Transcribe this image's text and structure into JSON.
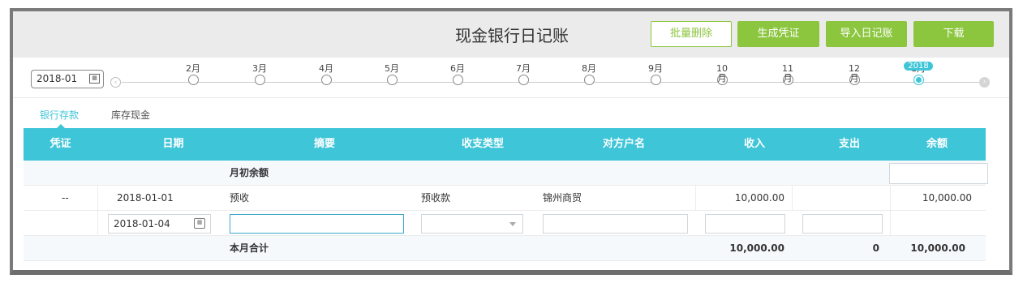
{
  "header": {
    "title": "现金银行日记账",
    "buttons": {
      "batch_delete": "批量删除",
      "generate_voucher": "生成凭证",
      "import_journal": "导入日记账",
      "download": "下载"
    }
  },
  "timeline": {
    "period_value": "2018-01",
    "months": [
      "2月",
      "3月",
      "4月",
      "5月",
      "6月",
      "7月",
      "8月",
      "9月",
      "10月",
      "11月",
      "12月",
      "1月"
    ],
    "active_month": "1月",
    "year_badge": "2018"
  },
  "tabs": [
    "银行存款",
    "库存现金"
  ],
  "active_tab": "银行存款",
  "table": {
    "columns": [
      "凭证",
      "日期",
      "摘要",
      "收支类型",
      "对方户名",
      "收入",
      "支出",
      "余额"
    ],
    "opening_label": "月初余额",
    "rows": [
      {
        "voucher": "--",
        "date": "2018-01-01",
        "summary": "预收",
        "type": "预收款",
        "counterparty": "锦州商贸",
        "income": "10,000.00",
        "expense": "",
        "balance": "10,000.00"
      }
    ],
    "edit_row": {
      "date": "2018-01-04"
    },
    "total": {
      "label": "本月合计",
      "income": "10,000.00",
      "expense": "0",
      "balance": "10,000.00"
    }
  },
  "colors": {
    "accent": "#3fc5d8",
    "green": "#8cc63f",
    "header_bg": "#ebebeb"
  }
}
